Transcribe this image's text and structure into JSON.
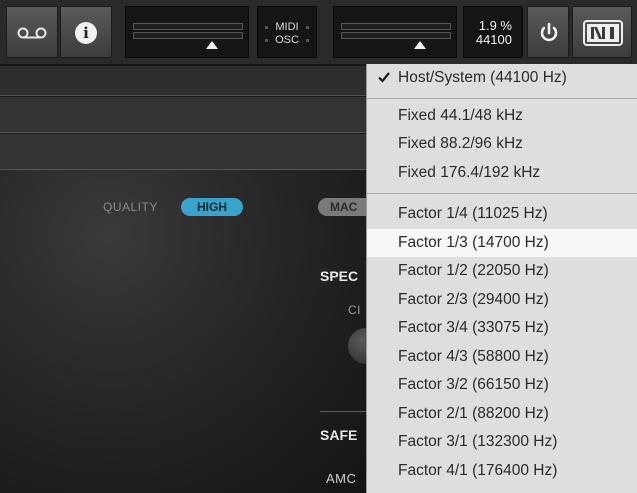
{
  "toolbar": {
    "midi_label": "MIDI",
    "osc_label": "OSC",
    "cpu_load": "1.9 %",
    "sample_rate": "44100"
  },
  "panel": {
    "quality_label": "QUALITY",
    "quality_value": "HIGH",
    "mac_label": "MAC",
    "spec_label": "SPEC",
    "ci_label": "CI",
    "safe_label": "SAFE",
    "amc_label": "AMC"
  },
  "colors": {
    "pill_active": "#3aa3c9",
    "menu_bg": "#dedede",
    "menu_highlight": "#f7f7f7"
  },
  "menu": {
    "host": "Host/System (44100 Hz)",
    "fixed": [
      "Fixed 44.1/48 kHz",
      "Fixed 88.2/96 kHz",
      "Fixed 176.4/192 kHz"
    ],
    "factors": [
      "Factor 1/4 (11025 Hz)",
      "Factor 1/3 (14700 Hz)",
      "Factor 1/2 (22050 Hz)",
      "Factor 2/3 (29400 Hz)",
      "Factor 3/4 (33075 Hz)",
      "Factor 4/3 (58800 Hz)",
      "Factor 3/2 (66150 Hz)",
      "Factor 2/1 (88200 Hz)",
      "Factor 3/1 (132300 Hz)",
      "Factor 4/1 (176400 Hz)"
    ],
    "selected": "Host/System (44100 Hz)",
    "hovered": "Factor 1/3 (14700 Hz)"
  }
}
